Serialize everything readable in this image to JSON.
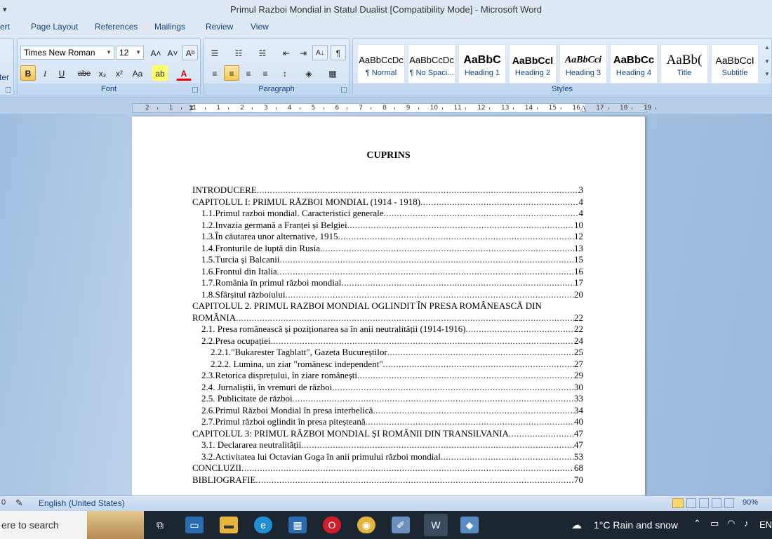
{
  "window": {
    "title": "Primul Razboi Mondial in Statul Dualist [Compatibility Mode] - Microsoft Word",
    "qat_glyph": "▾"
  },
  "tabs": [
    "ert",
    "Page Layout",
    "References",
    "Mailings",
    "Review",
    "View"
  ],
  "ribbon": {
    "font_name": "Times New Roman",
    "font_size": "12",
    "font_group_label": "Font",
    "paragraph_group_label": "Paragraph",
    "styles_group_label": "Styles",
    "left_partial_label": "ter",
    "buttons": {
      "grow": "A˄",
      "shrink": "A˅",
      "clear": "Aᵇ",
      "bold": "B",
      "italic": "I",
      "underline": "U",
      "strike": "abe",
      "subscript": "x₂",
      "superscript": "x²",
      "case": "Aa",
      "highlight": "ab",
      "fontcolor": "A",
      "bullets": "☰",
      "numbering": "☷",
      "multilevel": "☵",
      "outdent": "⇤",
      "indent": "⇥",
      "sort": "A↓",
      "pilcrow": "¶",
      "align_left": "≡",
      "align_center": "≡",
      "align_right": "≡",
      "justify": "≡",
      "spacing": "↕",
      "shading": "◈",
      "borders": "▦"
    },
    "styles": [
      {
        "sample": "AaBbCcDc",
        "name": "¶ Normal"
      },
      {
        "sample": "AaBbCcDc",
        "name": "¶ No Spaci..."
      },
      {
        "sample": "AaBbC",
        "name": "Heading 1"
      },
      {
        "sample": "AaBbCcl",
        "name": "Heading 2"
      },
      {
        "sample": "AaBbCci",
        "name": "Heading 3"
      },
      {
        "sample": "AaBbCc",
        "name": "Heading 4"
      },
      {
        "sample": "AaBb(",
        "name": "Title"
      },
      {
        "sample": "AaBbCcI",
        "name": "Subtitle"
      }
    ]
  },
  "ruler": {
    "labels": [
      "2",
      "1",
      "1",
      "1",
      "2",
      "3",
      "4",
      "5",
      "6",
      "7",
      "8",
      "9",
      "10",
      "11",
      "12",
      "13",
      "14",
      "15",
      "16",
      "17",
      "18",
      "19"
    ]
  },
  "document": {
    "heading": "CUPRINS",
    "toc": [
      {
        "text": "INTRODUCERE",
        "page": "3",
        "level": 0
      },
      {
        "text": "CAPITOLUL I: PRIMUL RĂZBOI MONDIAL (1914 - 1918)",
        "page": "4",
        "level": 0
      },
      {
        "text": "1.1.Primul razboi mondial. Caracteristici generale",
        "page": "4",
        "level": 1
      },
      {
        "text": "1.2.Invazia germană a Franței și Belgiei",
        "page": "10",
        "level": 1
      },
      {
        "text": "1.3.În căutarea unor alternative, 1915",
        "page": "12",
        "level": 1
      },
      {
        "text": "1.4.Fronturile de luptă din Rusia",
        "page": "13",
        "level": 1
      },
      {
        "text": "1.5.Turcia și Balcanii",
        "page": "15",
        "level": 1
      },
      {
        "text": "1.6.Frontul din Italia",
        "page": "16",
        "level": 1
      },
      {
        "text": "1.7.România în primul război mondial",
        "page": "17",
        "level": 1
      },
      {
        "text": "1.8.Sfârșitul războiului",
        "page": "20",
        "level": 1
      },
      {
        "text": "CAPITOLUL 2. PRIMUL RAZBOI MONDIAL  OGLINDIT ÎN PRESA ROMÂNEASCĂ  DIN",
        "page": "",
        "level": 0,
        "plain": true
      },
      {
        "text": "ROMÂNIA",
        "page": "22",
        "level": 0
      },
      {
        "text": "2.1. Presa românească și poziționarea sa în anii neutralității (1914-1916)",
        "page": "22",
        "level": 1
      },
      {
        "text": "2.2.Presa ocupației",
        "page": "24",
        "level": 1
      },
      {
        "text": "2.2.1.\"Bukarester Tagblatt\", Gazeta Bucureștilor",
        "page": "25",
        "level": 2
      },
      {
        "text": "2.2.2. Lumina, un ziar \"românesc independent\"",
        "page": "27",
        "level": 2
      },
      {
        "text": "2.3.Retorica disprețului, în ziare românești",
        "page": "29",
        "level": 1
      },
      {
        "text": "2.4. Jurnaliștii, în vremuri de război",
        "page": "30",
        "level": 1
      },
      {
        "text": "2.5. Publicitate de război",
        "page": "33",
        "level": 1
      },
      {
        "text": "2.6.Primul Război Mondial în presa interbelică",
        "page": "34",
        "level": 1
      },
      {
        "text": "2.7.Primul război oglindit în presa piteșteană",
        "page": "40",
        "level": 1
      },
      {
        "text": "CAPITOLUL 3: PRIMUL RĂZBOI MONDIAL ȘI ROMÂNII DIN TRANSILVANIA",
        "page": "47",
        "level": 0
      },
      {
        "text": "3.1. Declararea neutralității",
        "page": "47",
        "level": 1
      },
      {
        "text": "3.2.Activitatea lui Octavian Goga  în anii primului război mondial",
        "page": "53",
        "level": 1
      },
      {
        "text": "CONCLUZII",
        "page": "68",
        "level": 0
      },
      {
        "text": "BIBLIOGRAFIE",
        "page": "70",
        "level": 0
      }
    ]
  },
  "statusbar": {
    "language": "English (United States)",
    "zoom": "90%"
  },
  "taskbar": {
    "search_placeholder": "ere to search",
    "weather": "1°C  Rain and snow",
    "lang": "EN"
  }
}
